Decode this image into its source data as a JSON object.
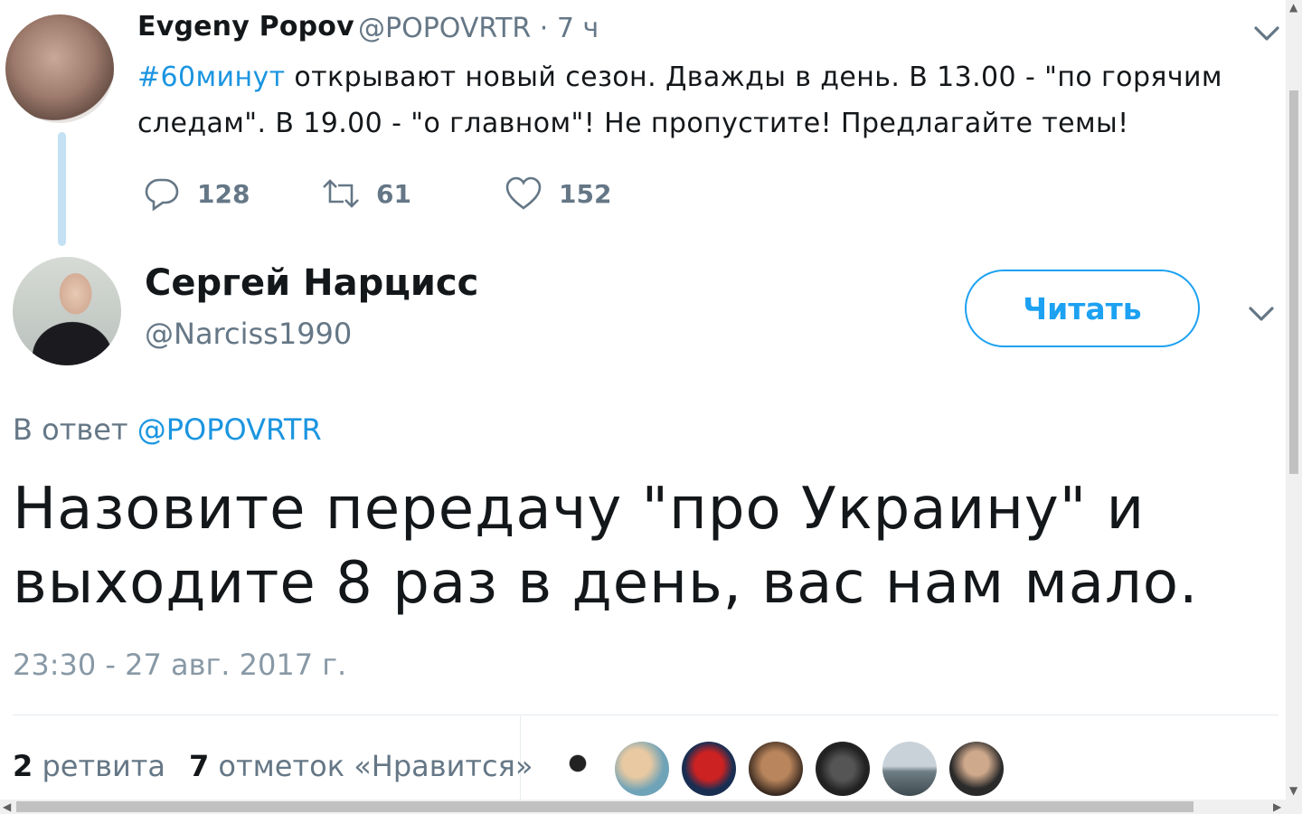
{
  "tweet1": {
    "author_name": "Evgeny Popov",
    "author_meta": "@POPOVRTR · 7 ч",
    "hashtag": "#60минут",
    "text": " открывают новый сезон. Дважды в день. В 13.00 - \"по горячим следам\". В 19.00 - \"о главном\"! Не пропустите! Предлагайте темы!",
    "replies": "128",
    "retweets": "61",
    "likes": "152"
  },
  "tweet2": {
    "author_name": "Сергей Нарцисс",
    "author_handle": "@Narciss1990",
    "follow_label": "Читать",
    "reply_prefix": "В ответ ",
    "reply_mention": "@POPOVRTR",
    "text": "Назовите передачу \"про Украину\" и выходите 8 раз в день, вас нам мало.",
    "timestamp": "23:30 - 27 авг. 2017 г.",
    "retweet_count": "2",
    "retweet_label": " ретвита",
    "like_count": "7",
    "like_label": " отметок «Нравится»"
  },
  "colors": {
    "accent": "#1da1f2",
    "link": "#1b95e0",
    "muted": "#657786",
    "thread_line": "#c4e1f4"
  },
  "icons": [
    "reply-icon",
    "retweet-icon",
    "like-icon",
    "chevron-down-icon"
  ]
}
